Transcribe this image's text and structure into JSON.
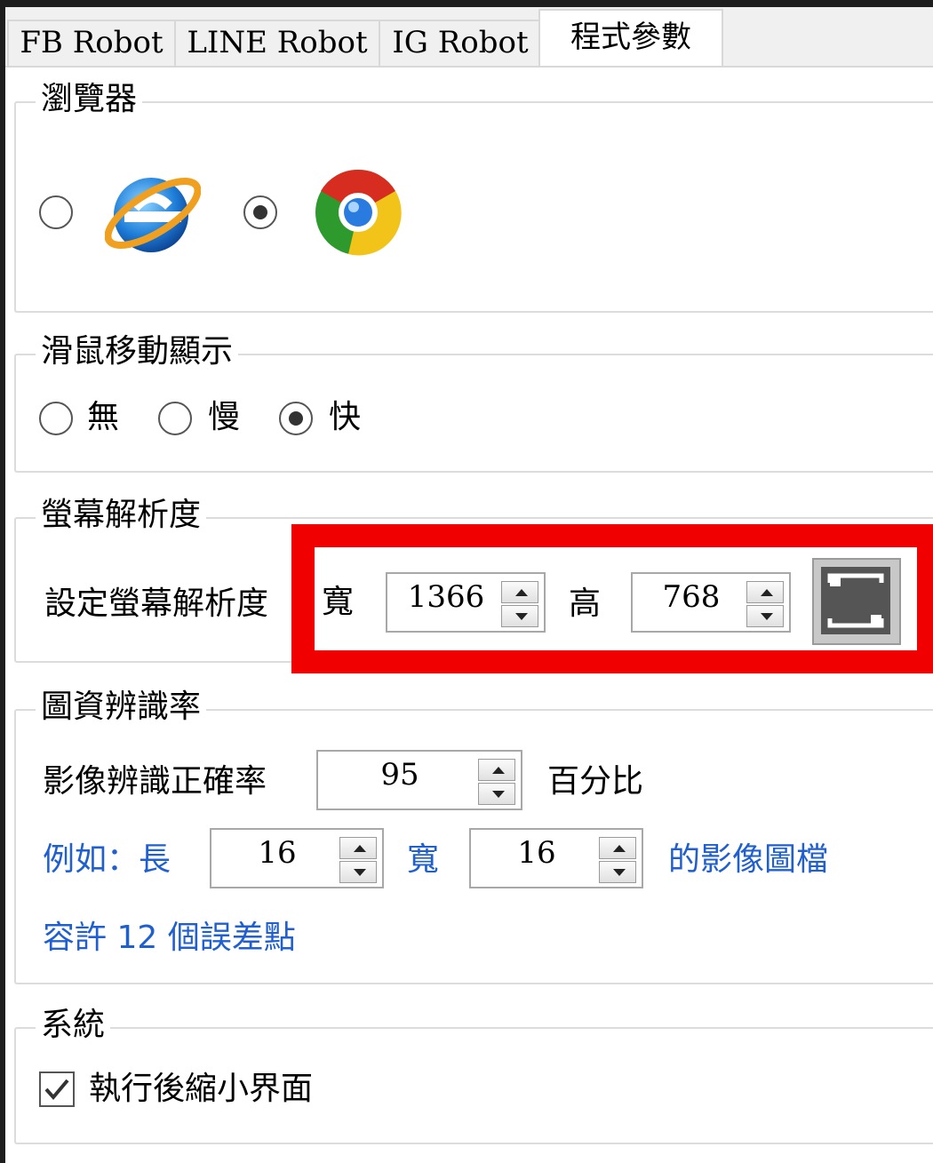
{
  "tabs": [
    {
      "label": "FB Robot"
    },
    {
      "label": "LINE Robot"
    },
    {
      "label": "IG Robot"
    },
    {
      "label": "程式參數",
      "active": true
    }
  ],
  "browser": {
    "title": "瀏覽器",
    "options": [
      {
        "icon": "internet-explorer-icon",
        "selected": false
      },
      {
        "icon": "chrome-icon",
        "selected": true
      }
    ]
  },
  "mouse": {
    "title": "滑鼠移動顯示",
    "options": [
      {
        "label": "無",
        "selected": false
      },
      {
        "label": "慢",
        "selected": false
      },
      {
        "label": "快",
        "selected": true
      }
    ]
  },
  "resolution": {
    "title": "螢幕解析度",
    "label": "設定螢幕解析度",
    "width_label": "寬",
    "width": "1366",
    "height_label": "高",
    "height": "768",
    "button_icon": "restore-screen-icon",
    "highlight_color": "#f00000"
  },
  "recognition": {
    "title": "圖資辨識率",
    "accuracy_label": "影像辨識正確率",
    "accuracy": "95",
    "percent_label": "百分比",
    "example_prefix": "例如：長",
    "example_length": "16",
    "example_width_label": "寬",
    "example_width": "16",
    "example_suffix": "的影像圖檔",
    "tolerance_text": "容許 12 個誤差點",
    "hint_color": "#1f5fd0"
  },
  "system": {
    "title": "系統",
    "minimize_label": "執行後縮小界面",
    "minimize_checked": true
  }
}
